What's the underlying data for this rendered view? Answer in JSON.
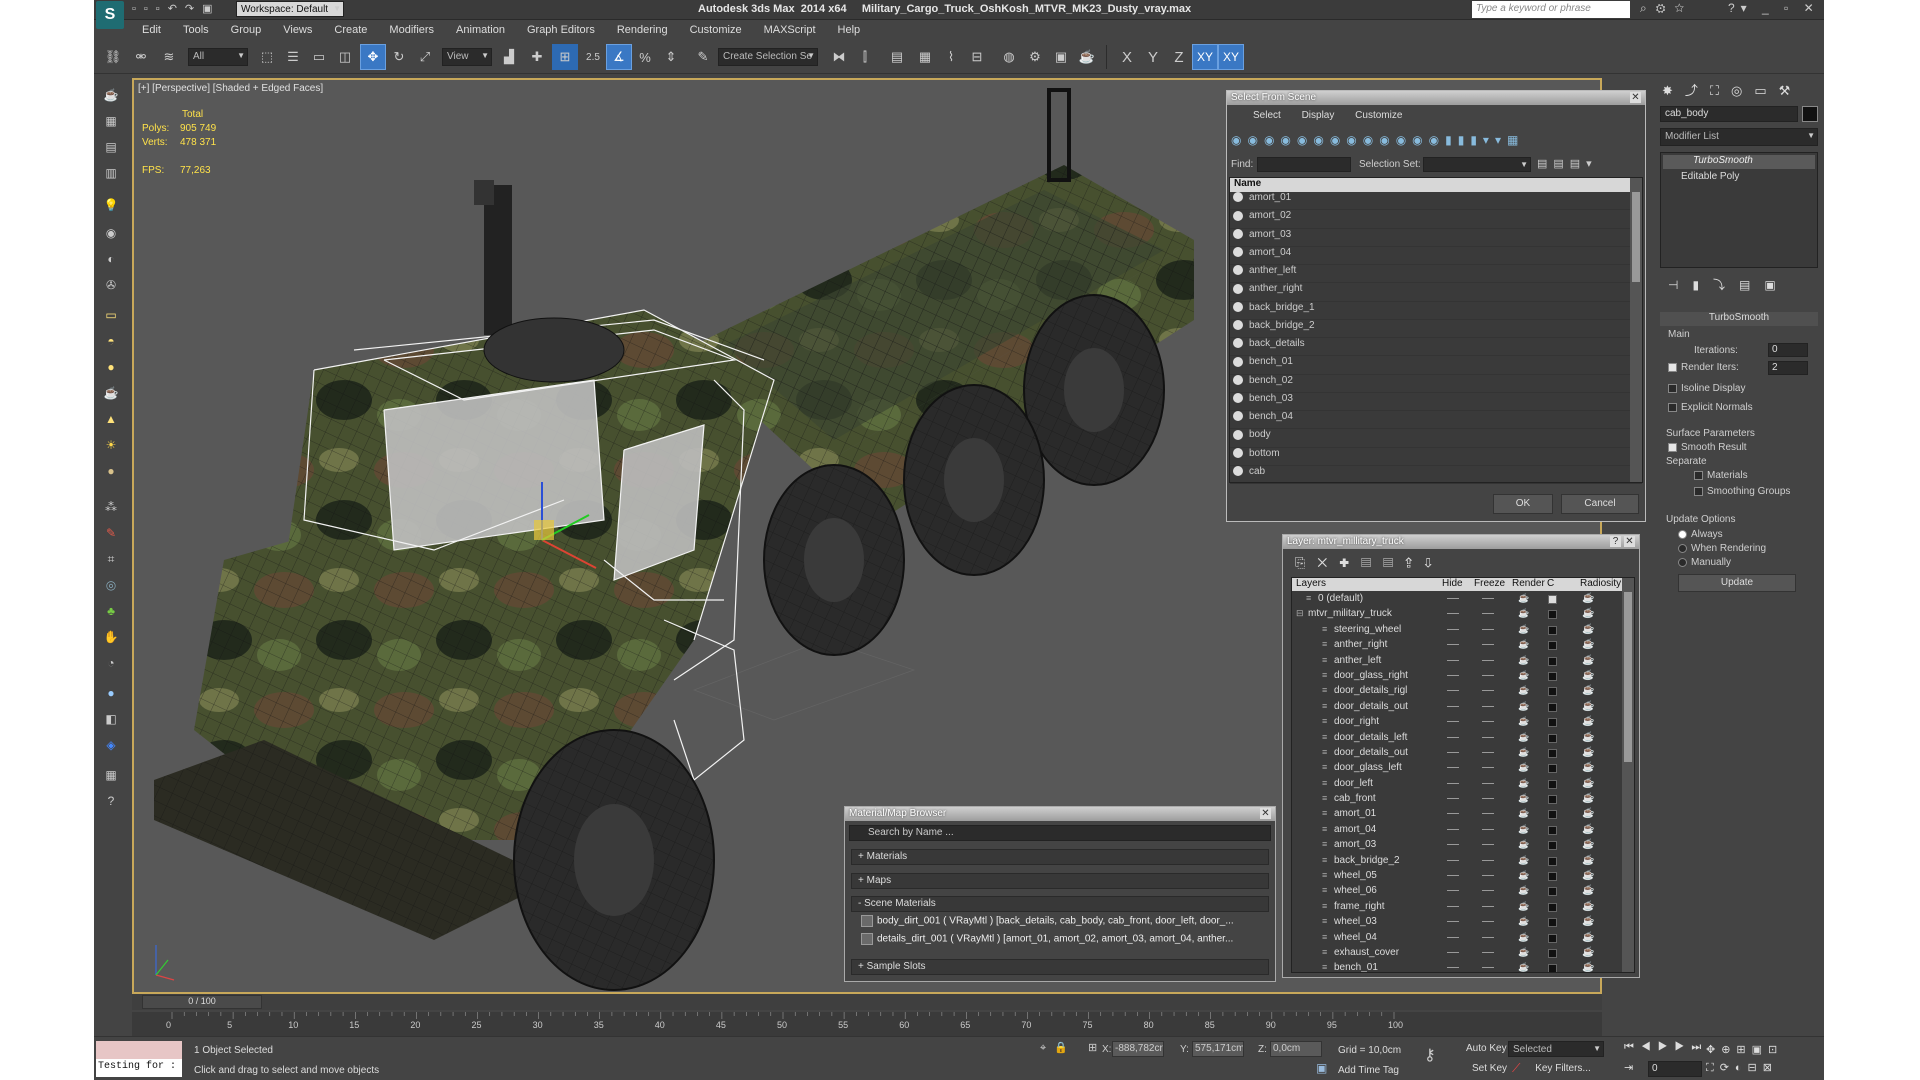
{
  "app": {
    "title": "Autodesk 3ds Max  2014 x64     Military_Cargo_Truck_OshKosh_MTVR_MK23_Dusty_vray.max",
    "workspace": "Workspace: Default",
    "search_placeholder": "Type a keyword or phrase"
  },
  "menu": [
    "Edit",
    "Tools",
    "Group",
    "Views",
    "Create",
    "Modifiers",
    "Animation",
    "Graph Editors",
    "Rendering",
    "Customize",
    "MAXScript",
    "Help"
  ],
  "toolbar": {
    "filter": "All",
    "view": "View",
    "snap_angle": "2.5",
    "selection_set": "Create Selection Se",
    "axes": [
      "X",
      "Y",
      "Z",
      "XY",
      "XY"
    ]
  },
  "viewport": {
    "label": "[+] [Perspective] [Shaded + Edged Faces]",
    "stats": {
      "header": "Total",
      "polys_label": "Polys:",
      "polys": "905 749",
      "verts_label": "Verts:",
      "verts": "478 371",
      "fps_label": "FPS:",
      "fps": "77,263"
    }
  },
  "select_scene": {
    "title": "Select From Scene",
    "menus": [
      "Select",
      "Display",
      "Customize"
    ],
    "find_label": "Find:",
    "selset_label": "Selection Set:",
    "column": "Name",
    "items": [
      "amort_01",
      "amort_02",
      "amort_03",
      "amort_04",
      "anther_left",
      "anther_right",
      "back_bridge_1",
      "back_bridge_2",
      "back_details",
      "bench_01",
      "bench_02",
      "bench_03",
      "bench_04",
      "body",
      "bottom",
      "cab"
    ],
    "ok": "OK",
    "cancel": "Cancel"
  },
  "layer": {
    "title": "Layer: mtvr_millitary_truck",
    "headers": [
      "Layers",
      "Hide",
      "Freeze",
      "Render",
      "C",
      "Radiosity"
    ],
    "rows": [
      "0 (default)",
      "mtvr_military_truck",
      "steering_wheel",
      "anther_right",
      "anther_left",
      "door_glass_right",
      "door_details_rigl",
      "door_details_out",
      "door_right",
      "door_details_left",
      "door_details_out",
      "door_glass_left",
      "door_left",
      "cab_front",
      "amort_01",
      "amort_04",
      "amort_03",
      "back_bridge_2",
      "wheel_05",
      "wheel_06",
      "frame_right",
      "wheel_03",
      "wheel_04",
      "exhaust_cover",
      "bench_01"
    ]
  },
  "material": {
    "title": "Material/Map Browser",
    "search": "Search by Name ...",
    "sections": [
      "+ Materials",
      "+ Maps",
      "- Scene Materials"
    ],
    "scene_materials": [
      "body_dirt_001 ( VRayMtl ) [back_details, cab_body, cab_front, door_left, door_...",
      "details_dirt_001 ( VRayMtl ) [amort_01, amort_02, amort_03, amort_04, anther..."
    ],
    "samples": "+ Sample Slots"
  },
  "command_panel": {
    "object_name": "cab_body",
    "modifier_list": "Modifier List",
    "stack": [
      "TurboSmooth",
      "Editable Poly"
    ],
    "rollout": "TurboSmooth",
    "main": "Main",
    "iterations_label": "Iterations:",
    "iterations": "0",
    "render_iters_label": "Render Iters:",
    "render_iters": "2",
    "isoline": "Isoline Display",
    "explicit": "Explicit Normals",
    "surface": "Surface Parameters",
    "smooth_result": "Smooth Result",
    "separate": "Separate",
    "materials": "Materials",
    "smoothing": "Smoothing Groups",
    "update_options": "Update Options",
    "always": "Always",
    "when_rendering": "When Rendering",
    "manually": "Manually",
    "update": "Update"
  },
  "timeline": {
    "frame": "0 / 100",
    "ticks": [
      "0",
      "5",
      "10",
      "15",
      "20",
      "25",
      "30",
      "35",
      "40",
      "45",
      "50",
      "55",
      "60",
      "65",
      "70",
      "75",
      "80",
      "85",
      "90",
      "95",
      "100"
    ]
  },
  "status": {
    "maxscript": "Testing for :",
    "selected": "1 Object Selected",
    "prompt": "Click and drag to select and move objects",
    "x_label": "X:",
    "x": "-888,782cr",
    "y_label": "Y:",
    "y": "575,171cm",
    "z_label": "Z:",
    "z": "0,0cm",
    "grid": "Grid = 10,0cm",
    "add_time_tag": "Add Time Tag",
    "auto_key": "Auto Key",
    "set_key": "Set Key",
    "selected_mode": "Selected",
    "key_filters": "Key Filters...",
    "frame_val": "0"
  },
  "colors": {
    "accent": "#3a78c4",
    "title_grad_top": "#cfcfcf",
    "viewport_bg": "#585858"
  }
}
